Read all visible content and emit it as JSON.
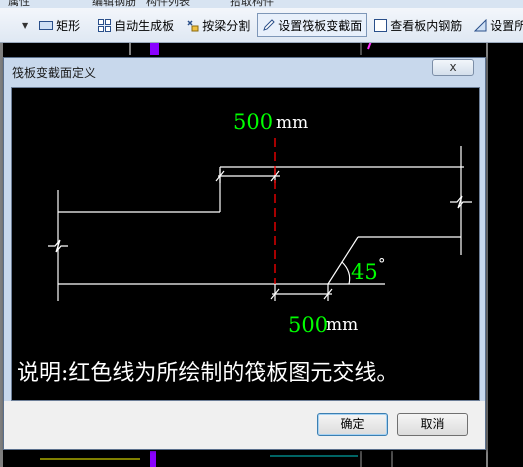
{
  "top_strip": {
    "item1": "属性",
    "item2": "编辑钢筋",
    "item3": "构件列表",
    "item4": "拾取构件"
  },
  "toolbar": {
    "rectangle": "矩形",
    "auto_generate": "自动生成板",
    "split_by_beam": "按梁分割",
    "set_section": "设置筏板变截面",
    "view_rebar": "查看板内钢筋",
    "set_truncated": "设置所"
  },
  "dialog": {
    "title": "筏板变截面定义",
    "close": "x",
    "ok": "确定",
    "cancel": "取消"
  },
  "drawing": {
    "top_width_value": "500",
    "top_width_unit": "mm",
    "bottom_width_value": "500",
    "bottom_width_unit": "mm",
    "angle_value": "45",
    "angle_unit": "°",
    "note": "说明:红色线为所绘制的筏板图元交线。"
  },
  "colors": {
    "dim_text": "#00ff00",
    "cut_line": "#ff0000",
    "note_text": "#ffffff",
    "accent_column": "#8a00ff"
  }
}
